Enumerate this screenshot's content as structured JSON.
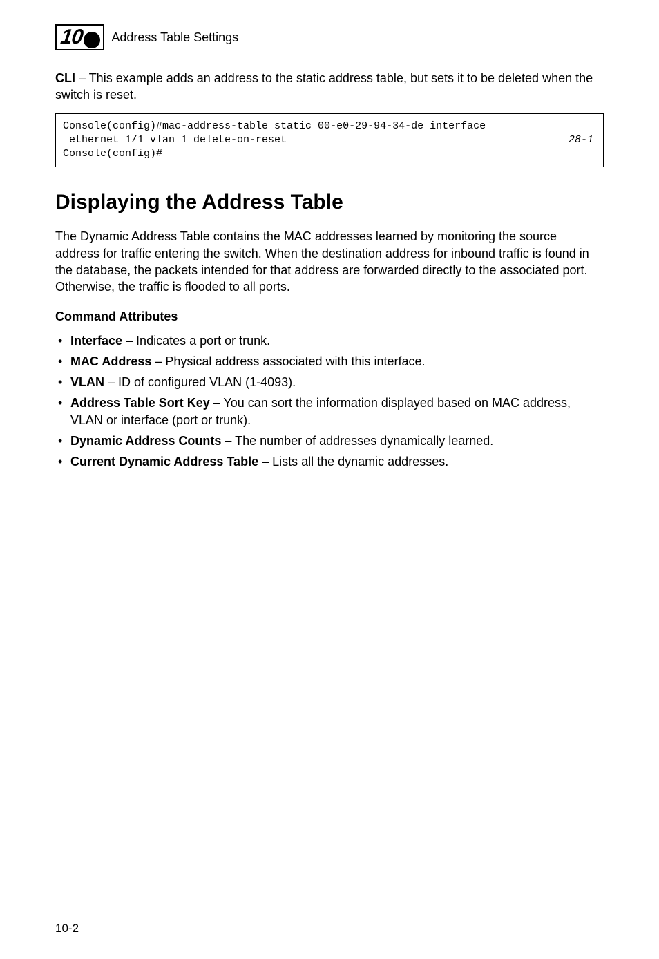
{
  "header": {
    "chapter_number": "10",
    "title": "Address Table Settings"
  },
  "intro": {
    "cli_label": "CLI",
    "cli_text": " – This example adds an address to the static address table, but sets it to be deleted when the switch is reset."
  },
  "code": {
    "line1": "Console(config)#mac-address-table static 00-e0-29-94-34-de interface",
    "line2": " ethernet 1/1 vlan 1 delete-on-reset",
    "line3": "Console(config)#",
    "ref": "28-1"
  },
  "section": {
    "heading": "Displaying the Address Table",
    "paragraph": "The Dynamic Address Table contains the MAC addresses learned by monitoring the source address for traffic entering the switch. When the destination address for inbound traffic is found in the database, the packets intended for that address are forwarded directly to the associated port. Otherwise, the traffic is flooded to all ports."
  },
  "attributes": {
    "heading": "Command Attributes",
    "items": [
      {
        "name": "Interface",
        "desc": " – Indicates a port or trunk."
      },
      {
        "name": "MAC Address",
        "desc": " – Physical address associated with this interface."
      },
      {
        "name": "VLAN",
        "desc": " – ID of configured VLAN (1-4093)."
      },
      {
        "name": "Address Table Sort Key",
        "desc": " – You can sort the information displayed based on MAC address, VLAN or interface (port or trunk)."
      },
      {
        "name": "Dynamic Address Counts",
        "desc": " – The number of addresses dynamically learned."
      },
      {
        "name": "Current Dynamic Address Table",
        "desc": " – Lists all the dynamic addresses."
      }
    ]
  },
  "footer": {
    "page": "10-2"
  }
}
